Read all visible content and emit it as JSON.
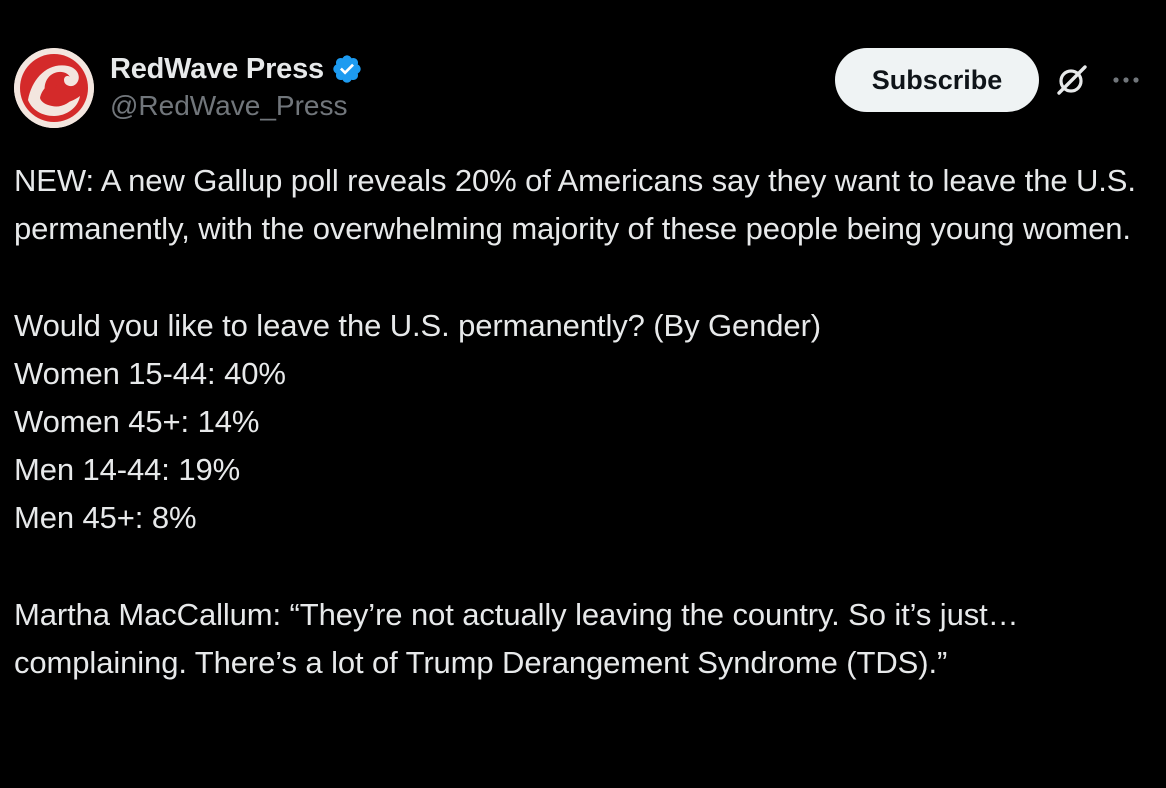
{
  "post": {
    "author": {
      "display_name": "RedWave Press",
      "handle": "@RedWave_Press",
      "verified": true,
      "avatar_color": "#d42a2a"
    },
    "subscribe_label": "Subscribe",
    "icons": {
      "verified": "verified-badge-icon",
      "grok": "grok-icon",
      "more": "more-icon"
    },
    "text": {
      "intro": "NEW: A new Gallup poll reveals 20% of Americans say they want to leave the U.S. permanently, with the overwhelming majority of these people being young women.",
      "question": "Would you like to leave the U.S. permanently? (By Gender)",
      "stats": [
        "Women 15-44: 40%",
        "Women 45+: 14%",
        "Men 14-44: 19%",
        "Men 45+: 8%"
      ],
      "quote": "Martha MacCallum: “They’re not actually leaving the country. So it’s just… complaining. There’s a lot of Trump Derangement Syndrome (TDS).”"
    }
  },
  "colors": {
    "background": "#000000",
    "text_primary": "#e7e9ea",
    "text_secondary": "#71767b",
    "verified_blue": "#1d9bf0",
    "button_bg": "#eff3f4",
    "button_text": "#0f1419"
  }
}
